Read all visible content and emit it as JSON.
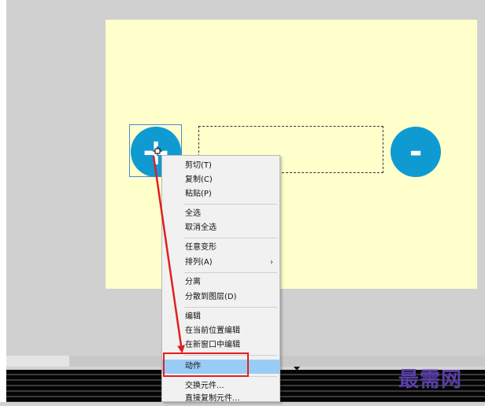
{
  "stage": {
    "plus_label": "+",
    "minus_label": "-"
  },
  "context_menu": {
    "items": [
      {
        "label": "剪切(T)"
      },
      {
        "label": "复制(C)"
      },
      {
        "label": "粘贴(P)"
      },
      {
        "label": "全选"
      },
      {
        "label": "取消全选"
      },
      {
        "label": "任意变形"
      },
      {
        "label": "排列(A)",
        "submenu_arrow": "›"
      },
      {
        "label": "分离"
      },
      {
        "label": "分散到图层(D)"
      },
      {
        "label": "编辑"
      },
      {
        "label": "在当前位置编辑"
      },
      {
        "label": "在新窗口中编辑"
      },
      {
        "label": "动作",
        "highlighted": true
      },
      {
        "label": "交换元件..."
      },
      {
        "label": "直接复制元件..."
      }
    ]
  },
  "watermark": "最需网",
  "colors": {
    "stage_bg": "#ffffcc",
    "button_blue": "#0f9bd1",
    "highlight": "#99ccf5",
    "annotation_red": "#e02020"
  }
}
